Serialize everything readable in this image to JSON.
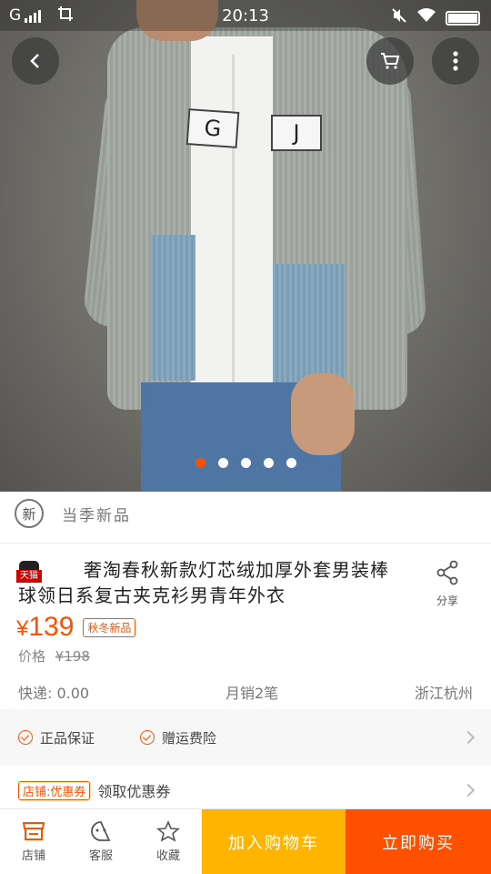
{
  "status_bar": {
    "carrier": "G",
    "time": "20:13"
  },
  "hero": {
    "patch_left": "G",
    "patch_right": "J",
    "dots_total": 5,
    "dots_active": 1
  },
  "badge": {
    "icon_char": "新",
    "text": "当季新品"
  },
  "product": {
    "store_badge": "天猫",
    "title": "奢淘春秋新款灯芯绒加厚外套男装棒球领日系复古夹克衫男青年外衣",
    "share_label": "分享",
    "currency": "¥",
    "price": "139",
    "price_tag": "秋冬新品",
    "orig_label": "价格",
    "orig_price": "¥198"
  },
  "info": {
    "shipping": "快递: 0.00",
    "monthly_sales": "月销2笔",
    "location": "浙江杭州"
  },
  "guarantees": [
    "正品保证",
    "赠运费险"
  ],
  "coupon": {
    "tag": "店铺:优惠券",
    "text": "领取优惠券"
  },
  "bottom_bar": {
    "store": "店铺",
    "service": "客服",
    "favorite": "收藏",
    "add_to_cart": "加入购物车",
    "buy_now": "立即购买"
  },
  "colors": {
    "accent": "#ff5000",
    "cart_button": "#ffb400"
  }
}
